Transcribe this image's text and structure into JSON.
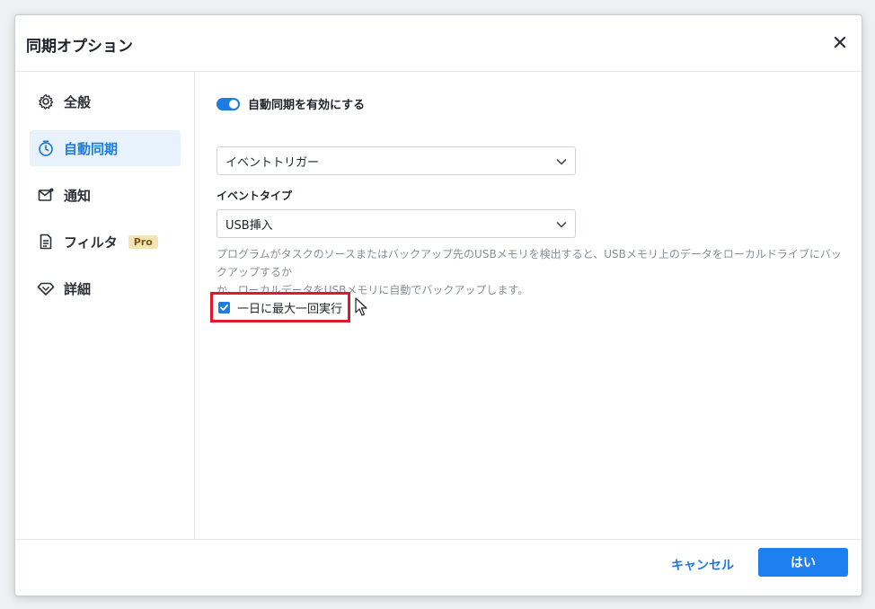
{
  "dialog": {
    "title": "同期オプション"
  },
  "sidebar": {
    "items": [
      {
        "label": "全般",
        "icon": "gear-icon"
      },
      {
        "label": "自動同期",
        "icon": "timer-icon"
      },
      {
        "label": "通知",
        "icon": "mail-notification-icon"
      },
      {
        "label": "フィルタ",
        "icon": "document-filter-icon",
        "badge": "Pro"
      },
      {
        "label": "詳細",
        "icon": "diamond-icon"
      }
    ],
    "active_index": 1
  },
  "content": {
    "toggle_label": "自動同期を有効にする",
    "toggle_on": true,
    "trigger_select": "イベントトリガー",
    "event_type_label": "イベントタイプ",
    "event_type_select": "USB挿入",
    "description_line1": "プログラムがタスクのソースまたはバックアップ先のUSBメモリを検出すると、USBメモリ上のデータをローカルドライブにバックアップするか",
    "description_line2": "か、ローカルデータをUSBメモリに自動でバックアップします。",
    "checkbox_label": "一日に最大一回実行",
    "checkbox_checked": true
  },
  "footer": {
    "cancel_label": "キャンセル",
    "ok_label": "はい"
  },
  "colors": {
    "accent": "#1e7be0",
    "highlight_border": "#e0182a",
    "pro_badge_bg": "#f4e3b8"
  }
}
